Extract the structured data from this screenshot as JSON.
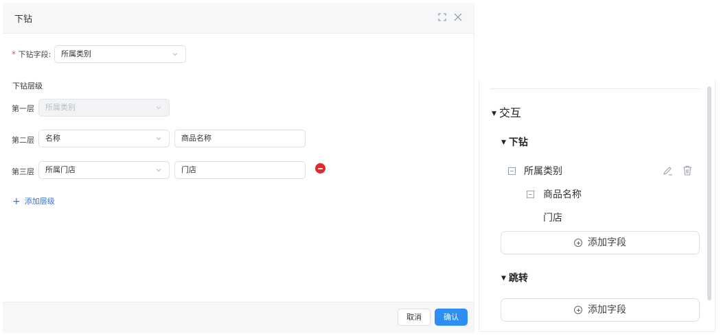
{
  "modal": {
    "title": "下钻",
    "field_label": "下钻字段:",
    "field_required_mark": "*",
    "field_value": "所属类别",
    "section_title": "下钻层级",
    "levels": [
      {
        "label": "第一层",
        "select": "所属类别",
        "disabled": true
      },
      {
        "label": "第二层",
        "select": "名称",
        "alias": "商品名称"
      },
      {
        "label": "第三层",
        "select": "所属门店",
        "alias": "门店",
        "deletable": true
      }
    ],
    "add_level": "添加层级",
    "cancel": "取消",
    "confirm": "确认"
  },
  "panel": {
    "group_title": "交互",
    "drilldown_title": "下钻",
    "tree": [
      {
        "label": "所属类别"
      },
      {
        "label": "商品名称"
      },
      {
        "label": "门店"
      }
    ],
    "add_field": "添加字段",
    "jump_title": "跳转",
    "jump_add_field": "添加字段"
  },
  "colors": {
    "primary": "#2f8ef4",
    "link": "#2f73d8",
    "danger": "#e0282d",
    "header_bg": "#f6f7f9"
  }
}
